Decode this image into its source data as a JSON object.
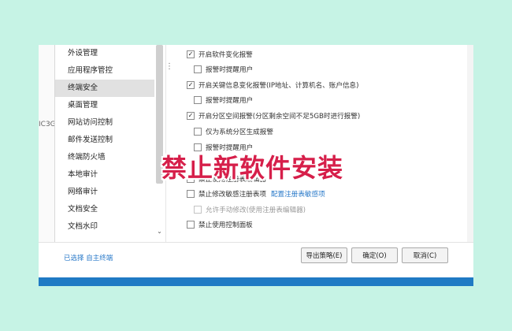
{
  "window": {
    "clipped_text": "IC3G"
  },
  "sidebar": {
    "items": [
      {
        "label": "外设管理"
      },
      {
        "label": "应用程序管控"
      },
      {
        "label": "终端安全"
      },
      {
        "label": "桌面管理"
      },
      {
        "label": "网站访问控制"
      },
      {
        "label": "邮件发送控制"
      },
      {
        "label": "终端防火墙"
      },
      {
        "label": "本地审计"
      },
      {
        "label": "网络审计"
      },
      {
        "label": "文档安全"
      },
      {
        "label": "文档水印"
      }
    ],
    "active_index": 2
  },
  "options": [
    {
      "label": "开启软件变化报警",
      "checked": true
    },
    {
      "label": "报警时提醒用户",
      "checked": false
    },
    {
      "label": "开启关键信息变化报警(IP地址、计算机名、账户信息)",
      "checked": true
    },
    {
      "label": "报警时提醒用户",
      "checked": false
    },
    {
      "label": "开启分区空间报警(分区剩余空间不足5GB时进行报警)",
      "checked": true
    },
    {
      "label": "仅为系统分区生成报警",
      "checked": false
    },
    {
      "label": "报警时提醒用户",
      "checked": false
    },
    {
      "label": "禁止使用注册表编辑器",
      "checked": false
    },
    {
      "label": "禁止修改敏感注册表项",
      "checked": false,
      "link": "配置注册表敏感项"
    },
    {
      "label": "允许手动修改(使用注册表编辑器)",
      "checked": false,
      "disabled": true
    },
    {
      "label": "禁止使用控制面板",
      "checked": false
    }
  ],
  "footer": {
    "status": "已选择 自主终端",
    "export_button": "导出策略(E)",
    "ok_button": "确定(O)",
    "cancel_button": "取消(C)"
  },
  "overlay": {
    "title": "禁止新软件安装"
  },
  "colors": {
    "background": "#c6f3e5",
    "overlay_text": "#d61f4a",
    "link": "#2a7ac9",
    "accent_bar": "#1f7ac4"
  }
}
